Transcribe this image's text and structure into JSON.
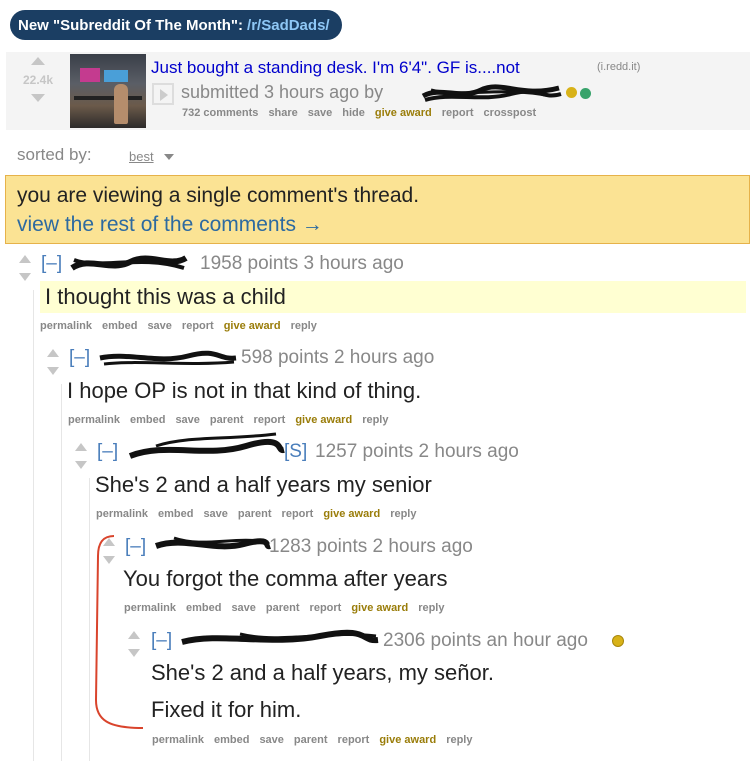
{
  "banner": {
    "prefix": "New \"Subreddit Of The Month\":",
    "subreddit": "/r/SadDads/"
  },
  "post": {
    "score": "22.4k",
    "title": "Just bought a standing desk. I'm 6'4\". GF is....not",
    "domain": "(i.redd.it)",
    "submitted": "submitted 3 hours ago by",
    "actions": [
      "732 comments",
      "share",
      "save",
      "hide",
      "give award",
      "report",
      "crosspost"
    ]
  },
  "sort": {
    "label": "sorted by:",
    "value": "best"
  },
  "notice": {
    "text": "you are viewing a single comment's thread.",
    "link": "view the rest of the comments →"
  },
  "comments": [
    {
      "toggle": "[–]",
      "meta": "1958 points 3 hours ago",
      "text": "I thought this was a child",
      "actions": [
        "permalink",
        "embed",
        "save",
        "report",
        "give award",
        "reply"
      ]
    },
    {
      "toggle": "[–]",
      "meta": "598 points 2 hours ago",
      "text": "I hope OP is not in that kind of thing.",
      "actions": [
        "permalink",
        "embed",
        "save",
        "parent",
        "report",
        "give award",
        "reply"
      ]
    },
    {
      "toggle": "[–]",
      "flair": "[S]",
      "meta": "1257 points 2 hours ago",
      "text": "She's 2 and a half years my senior",
      "actions": [
        "permalink",
        "embed",
        "save",
        "parent",
        "report",
        "give award",
        "reply"
      ]
    },
    {
      "toggle": "[–]",
      "meta": "1283 points 2 hours ago",
      "text": "You forgot the comma after years",
      "actions": [
        "permalink",
        "embed",
        "save",
        "parent",
        "report",
        "give award",
        "reply"
      ]
    },
    {
      "toggle": "[–]",
      "meta": "2306 points an hour ago",
      "text": "She's 2 and a half years, my señor.",
      "text2": "Fixed it for him.",
      "actions": [
        "permalink",
        "embed",
        "save",
        "parent",
        "report",
        "give award",
        "reply"
      ]
    }
  ],
  "colors": {
    "banner": "#1b3e63",
    "link": "#0000cc",
    "notice_bg": "#fbe394",
    "highlight": "#ffffd2",
    "annotation": "#d9442c"
  }
}
